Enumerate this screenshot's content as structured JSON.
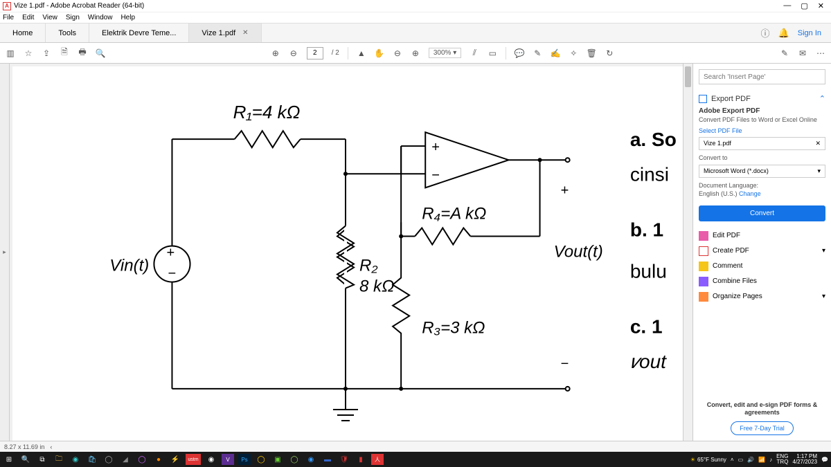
{
  "window": {
    "title": "Vize 1.pdf - Adobe Acrobat Reader (64-bit)",
    "app_letter": "A"
  },
  "menu": [
    "File",
    "Edit",
    "View",
    "Sign",
    "Window",
    "Help"
  ],
  "tabs": {
    "home": "Home",
    "tools": "Tools",
    "doc1": "Elektrik Devre Teme...",
    "doc2": "Vize 1.pdf",
    "signin": "Sign In"
  },
  "toolbar": {
    "page_current": "2",
    "page_total": "/ 2",
    "zoom": "300%"
  },
  "rightpanel": {
    "search_placeholder": "Search 'Insert Page'",
    "export_head": "Export PDF",
    "export_sub": "Adobe Export PDF",
    "export_desc": "Convert PDF Files to Word or Excel Online",
    "select_label": "Select PDF File",
    "file": "Vize 1.pdf",
    "convert_to": "Convert to",
    "format": "Microsoft Word (*.docx)",
    "lang_label": "Document Language:",
    "lang_value": "English (U.S.)",
    "change": "Change",
    "convert_btn": "Convert",
    "tools": {
      "edit": "Edit PDF",
      "create": "Create PDF",
      "comment": "Comment",
      "combine": "Combine Files",
      "organize": "Organize Pages"
    },
    "foot_msg": "Convert, edit and e-sign PDF forms & agreements",
    "trial": "Free 7-Day Trial"
  },
  "status": {
    "size": "8.27 x 11.69 in"
  },
  "taskbar": {
    "weather": "65°F Sunny",
    "lang1": "ENG",
    "lang2": "TRQ",
    "time": "1:17 PM",
    "date": "4/27/2023"
  },
  "circuit": {
    "vin": "Vin(t)",
    "r1": "R₁=4 kΩ",
    "r2a": "R₂",
    "r2b": "8 kΩ",
    "r3": "R₃=3 kΩ",
    "r4": "R₄=A kΩ",
    "vout": "Vout(t)",
    "plus": "+",
    "minus": "−",
    "qa": "a.  So",
    "qa2": "cinsi",
    "qb": "b.  1",
    "qb2": "bulu",
    "qc": "c.   1",
    "qc2": "𝑣out"
  }
}
